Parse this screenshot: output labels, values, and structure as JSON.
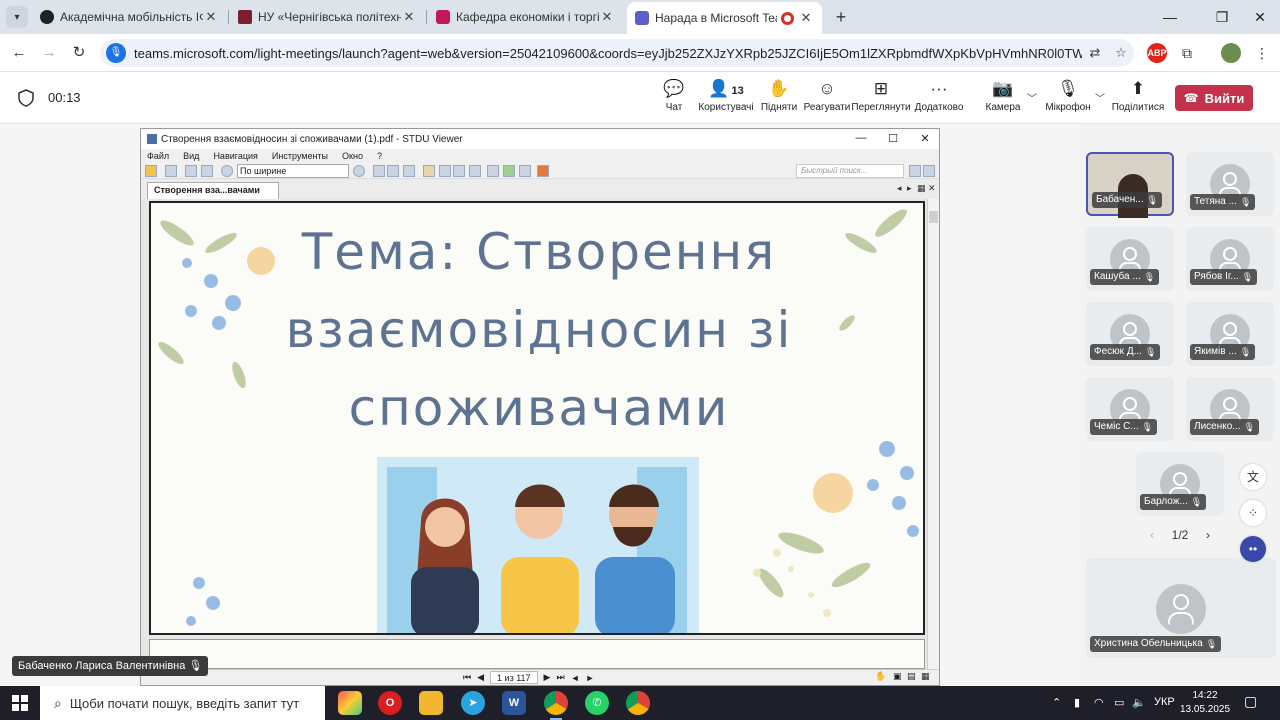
{
  "browser": {
    "tabs": [
      {
        "title": "Академічна мобільність ІФНТУ",
        "active": false
      },
      {
        "title": "НУ «Чернігівська політехніка»",
        "active": false
      },
      {
        "title": "Кафедра економіки і торгівлі |",
        "active": false
      },
      {
        "title": "Нарада в Microsoft Teams |",
        "active": true
      }
    ],
    "url": "teams.microsoft.com/light-meetings/launch?agent=web&version=25042109600&coords=eyJjb252ZXJzYXRpb25JZCI6IjE5Om1lZXRpbmdfWXpKbVpHVmhNR0l0TWpFellTMDBNRFlx...",
    "extensions": [
      "ABP"
    ]
  },
  "teams": {
    "timer": "00:13",
    "toolbar": {
      "chat": "Чат",
      "people": "Користувачі",
      "people_count": "13",
      "raise": "Підняти",
      "react": "Реагувати",
      "view": "Переглянути",
      "more": "Додатково",
      "camera": "Камера",
      "mic": "Мікрофон",
      "share": "Поділитися",
      "leave": "Вийти"
    },
    "presenter": "Бабаченко Лариса Валентинівна",
    "participants": [
      {
        "name": "Бабачен...",
        "video": true
      },
      {
        "name": "Тетяна ...",
        "video": false
      },
      {
        "name": "Кашуба ...",
        "video": false
      },
      {
        "name": "Рябов Іг...",
        "video": false
      },
      {
        "name": "Фесюк Д...",
        "video": false
      },
      {
        "name": "Якимів ...",
        "video": false
      },
      {
        "name": "Чеміс С...",
        "video": false
      },
      {
        "name": "Лисенко...",
        "video": false
      },
      {
        "name": "Барлож...",
        "video": false
      }
    ],
    "gallery_page": "1/2",
    "spotlight": "Христина Обельницька"
  },
  "viewer": {
    "window_title": "Створення взаємовідносин зі споживачами (1).pdf - STDU Viewer",
    "menu": [
      "Файл",
      "Вид",
      "Навигация",
      "Инструменты",
      "Окно",
      "?"
    ],
    "zoom": "По ширине",
    "search_placeholder": "Быстрый поиск...",
    "doc_tab": "Створення вза...вачами (1).pdf",
    "page_indicator": "1 из 117",
    "slide_title": "Тема: Створення взаємовідносин зі споживачами"
  },
  "taskbar": {
    "search": "Щоби почати пошук, введіть запит тут",
    "lang": "УКР",
    "time": "14:22",
    "date": "13.05.2025"
  }
}
